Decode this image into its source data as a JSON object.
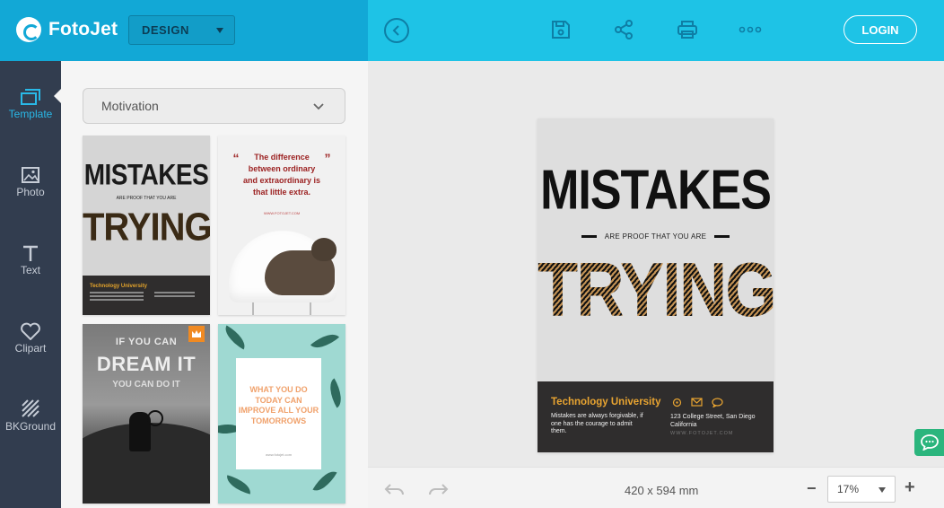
{
  "header": {
    "logo_text": "FotoJet",
    "mode_select": "DESIGN",
    "login_label": "LOGIN",
    "icons": [
      "back-icon",
      "save-icon",
      "share-icon",
      "print-icon",
      "more-icon"
    ]
  },
  "nav": {
    "items": [
      {
        "label": "Template",
        "icon": "template-icon"
      },
      {
        "label": "Photo",
        "icon": "photo-icon"
      },
      {
        "label": "Text",
        "icon": "text-icon"
      },
      {
        "label": "Clipart",
        "icon": "clipart-icon"
      },
      {
        "label": "BKGround",
        "icon": "background-icon"
      }
    ],
    "active": "Template"
  },
  "panel": {
    "category": "Motivation",
    "thumbs": {
      "t1": {
        "line1": "MISTAKES",
        "line2": "ARE PROOF THAT YOU ARE",
        "line3": "TRYING",
        "org": "Technology University"
      },
      "t2": {
        "quote": "The difference between ordinary and extraordinary is that little extra.",
        "site": "WWW.FOTOJET.COM"
      },
      "t3": {
        "line1": "IF YOU CAN",
        "line2": "DREAM IT",
        "line3": "YOU CAN DO IT"
      },
      "t4": {
        "text": "WHAT YOU DO TODAY CAN IMPROVE ALL YOUR TOMORROWS",
        "site": "www.fotojet.com"
      }
    }
  },
  "canvas": {
    "headline": "MISTAKES",
    "subline": "ARE PROOF THAT YOU ARE",
    "emphasis": "TRYING",
    "university": "Technology University",
    "description": "Mistakes are always forgivable, if one has the courage to admit them.",
    "address": "123 College Street, San Diego California",
    "website": "WWW.FOTOJET.COM"
  },
  "bottom": {
    "dimensions": "420 x 594 mm",
    "zoom": "17%"
  },
  "colors": {
    "header_left": "#12a8d6",
    "header_right": "#1ec3e6",
    "nav_bg": "#323d4f",
    "accent": "#29b9e8",
    "footer_orange": "#e8a431",
    "chat_green": "#2bb57d"
  }
}
